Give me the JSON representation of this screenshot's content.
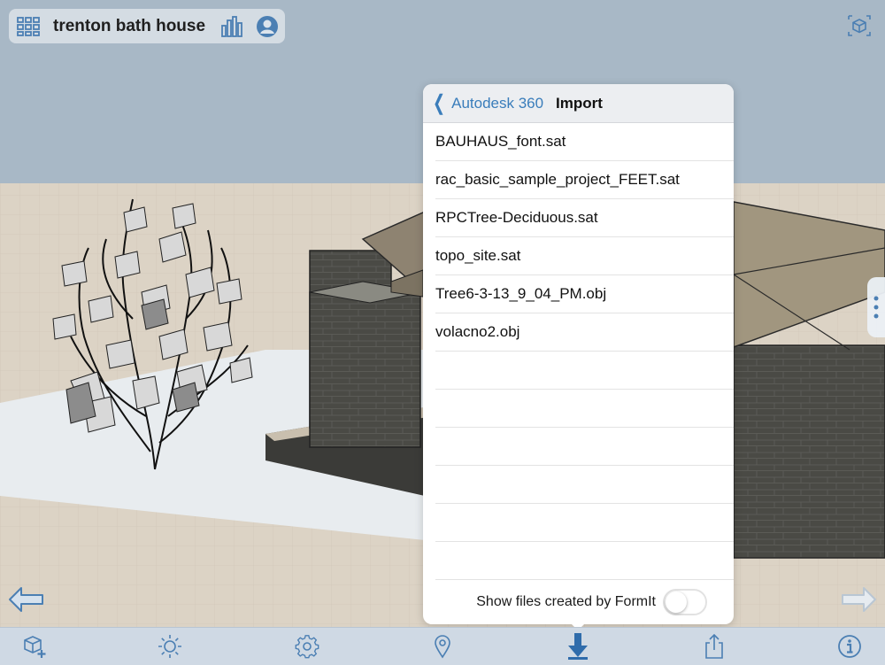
{
  "project": {
    "title": "trenton bath house",
    "icons": [
      "grid-icon",
      "chart-icon",
      "user-profile-icon"
    ]
  },
  "import_panel": {
    "back_label": "Autodesk 360",
    "title": "Import",
    "files": [
      "BAUHAUS_font.sat",
      "rac_basic_sample_project_FEET.sat",
      "RPCTree-Deciduous.sat",
      "topo_site.sat",
      "Tree6-3-13_9_04_PM.obj",
      "volacno2.obj"
    ],
    "footer_label": "Show files created by FormIt",
    "show_formit_files": false
  },
  "toolbar": {
    "buttons": [
      "add-object-icon",
      "sun-icon",
      "settings-icon",
      "location-pin-icon",
      "import-icon",
      "share-icon",
      "info-icon"
    ],
    "active": "import-icon"
  },
  "colors": {
    "accent": "#3a7dbb",
    "toolbar_icon": "#4b7fb3",
    "sky": "#a8b8c6",
    "ground": "#dcd3c5"
  }
}
